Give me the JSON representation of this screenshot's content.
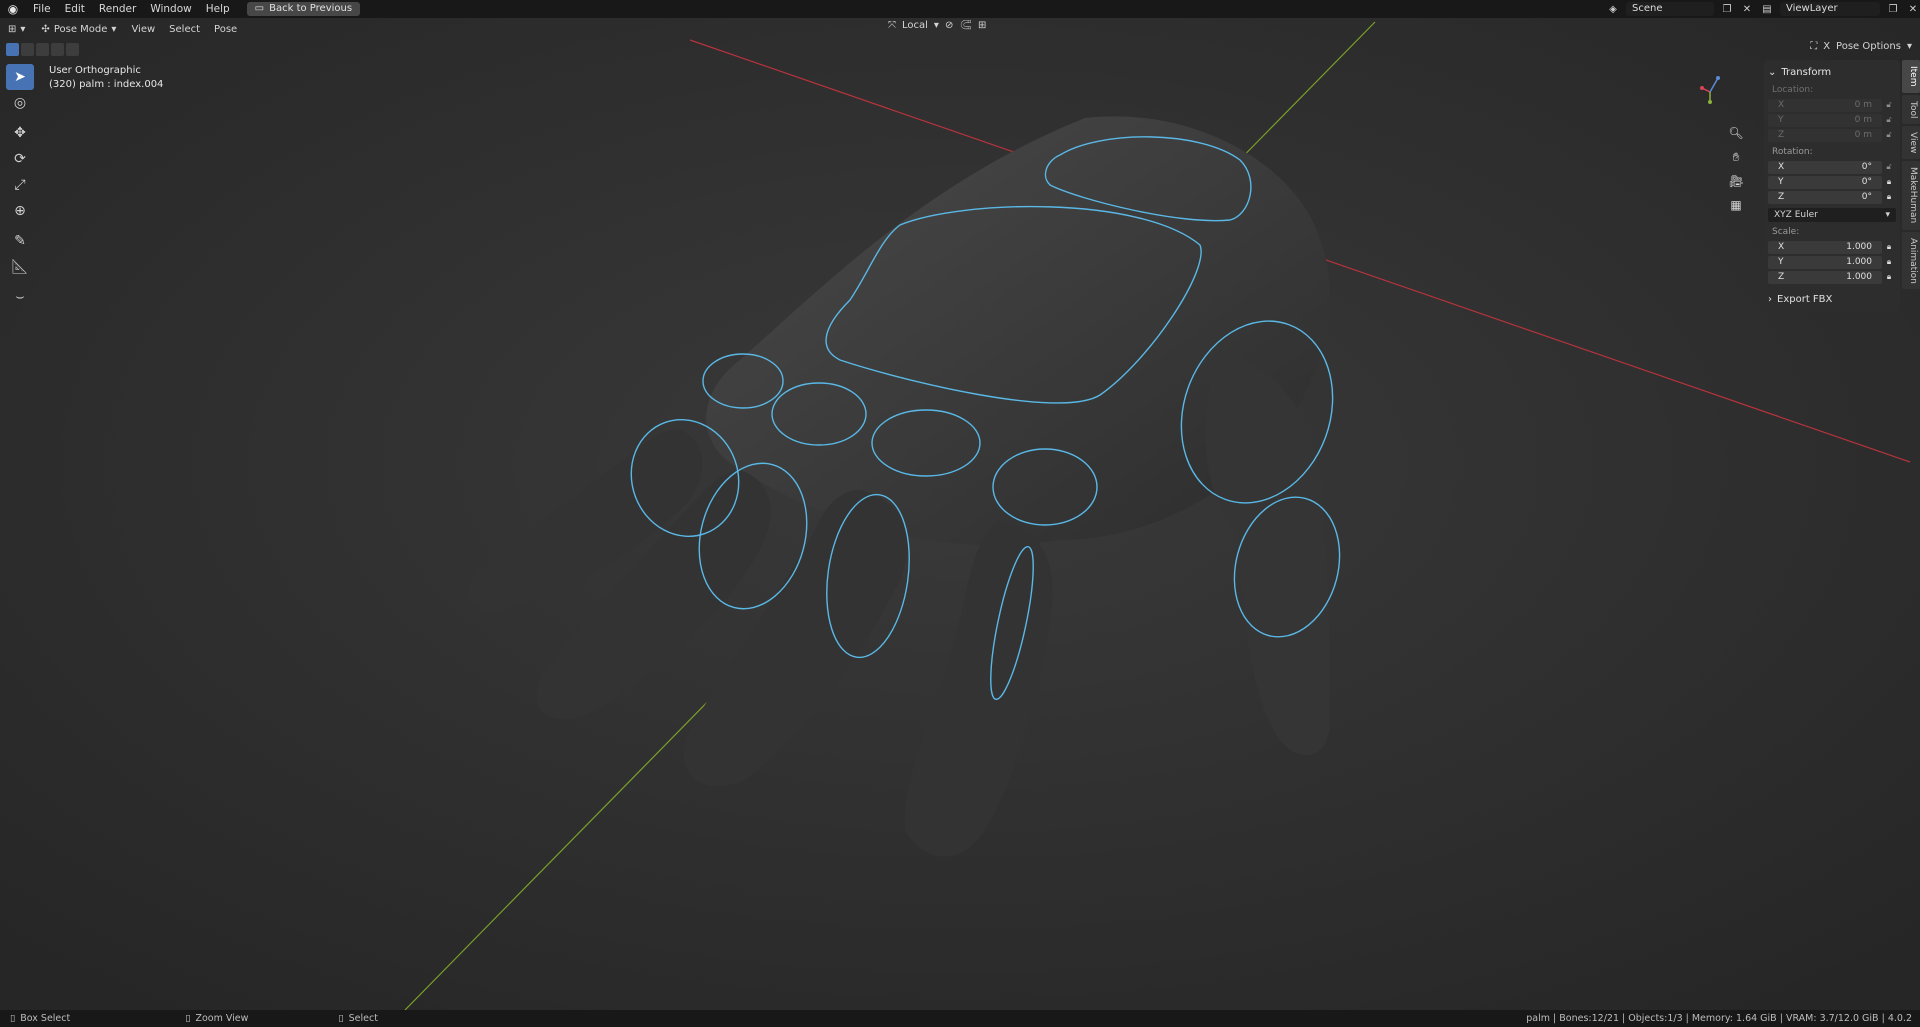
{
  "menu": {
    "items": [
      "File",
      "Edit",
      "Render",
      "Window",
      "Help"
    ],
    "back_button": "Back to Previous"
  },
  "top_right": {
    "scene": "Scene",
    "view_layer": "ViewLayer"
  },
  "header": {
    "mode": "Pose Mode",
    "items": [
      "View",
      "Select",
      "Pose"
    ],
    "transform_orientation": "Local",
    "pose_options": "Pose Options"
  },
  "viewport": {
    "view_name": "User Orthographic",
    "active_info": "(320) palm : index.004"
  },
  "npanel": {
    "title": "Transform",
    "location_label": "Location:",
    "location": [
      {
        "axis": "X",
        "value": "0 m"
      },
      {
        "axis": "Y",
        "value": "0 m"
      },
      {
        "axis": "Z",
        "value": "0 m"
      }
    ],
    "rotation_label": "Rotation:",
    "rotation": [
      {
        "axis": "X",
        "value": "0°"
      },
      {
        "axis": "Y",
        "value": "0°"
      },
      {
        "axis": "Z",
        "value": "0°"
      }
    ],
    "rotation_mode": "XYZ Euler",
    "scale_label": "Scale:",
    "scale": [
      {
        "axis": "X",
        "value": "1.000"
      },
      {
        "axis": "Y",
        "value": "1.000"
      },
      {
        "axis": "Z",
        "value": "1.000"
      }
    ],
    "export_section": "Export FBX"
  },
  "side_tabs": [
    "Item",
    "Tool",
    "View",
    "MakeHuman",
    "Animation"
  ],
  "status": {
    "left": [
      "Box Select",
      "Zoom View",
      "Select"
    ],
    "right": "palm | Bones:12/21 | Objects:1/3 | Memory: 1.64 GiB | VRAM: 3.7/12.0 GiB | 4.0.2"
  },
  "colors": {
    "accent": "#4772b3",
    "bone_outline": "#5ab8e6",
    "x_axis": "#b5333d",
    "y_axis": "#7aa12a",
    "background": "#2b2b2b"
  }
}
